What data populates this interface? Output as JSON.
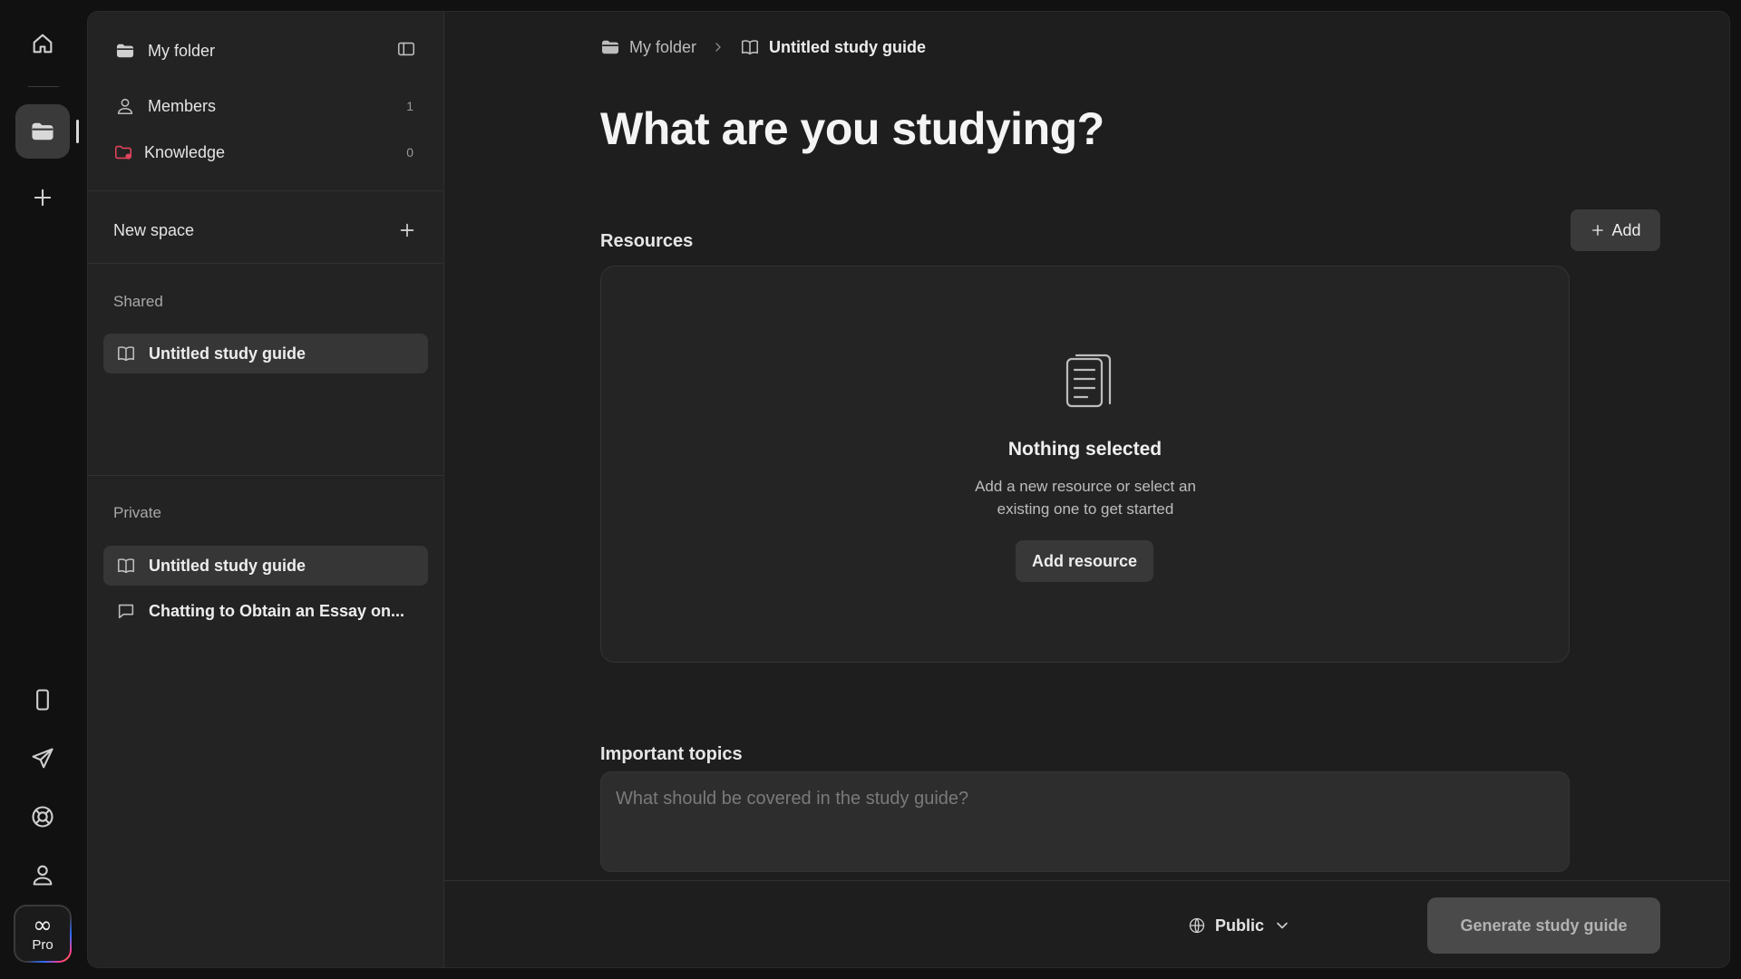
{
  "rail": {
    "top_icons": [
      "home-icon",
      "folder-icon",
      "plus-icon"
    ],
    "bottom_icons": [
      "mobile-icon",
      "send-icon",
      "help-icon",
      "user-icon"
    ],
    "pro_symbol": "∞",
    "pro_label": "Pro"
  },
  "sidebar": {
    "folder_title": "My folder",
    "members_label": "Members",
    "members_count": "1",
    "knowledge_label": "Knowledge",
    "knowledge_count": "0",
    "new_space_label": "New space",
    "shared_heading": "Shared",
    "shared_items": [
      {
        "label": "Untitled study guide",
        "icon": "book-icon"
      }
    ],
    "private_heading": "Private",
    "private_items": [
      {
        "label": "Untitled study guide",
        "icon": "book-icon"
      },
      {
        "label": "Chatting to Obtain an Essay on...",
        "icon": "chat-icon"
      }
    ]
  },
  "main": {
    "breadcrumb": {
      "folder": "My folder",
      "current": "Untitled study guide"
    },
    "title": "What are you studying?",
    "resources": {
      "heading": "Resources",
      "add_label": "Add",
      "empty_title": "Nothing selected",
      "empty_desc": "Add a new resource or select an existing one to get started",
      "add_resource_label": "Add resource"
    },
    "topics": {
      "heading": "Important topics",
      "placeholder": "What should be covered in the study guide?",
      "value": ""
    },
    "footer": {
      "visibility": "Public",
      "generate_label": "Generate study guide"
    }
  },
  "colors": {
    "background": "#111111",
    "panel": "#1e1e1e",
    "sidebar": "#232323",
    "knowledge_icon": "#e0445b",
    "button_disabled": "#4a4a4a"
  }
}
